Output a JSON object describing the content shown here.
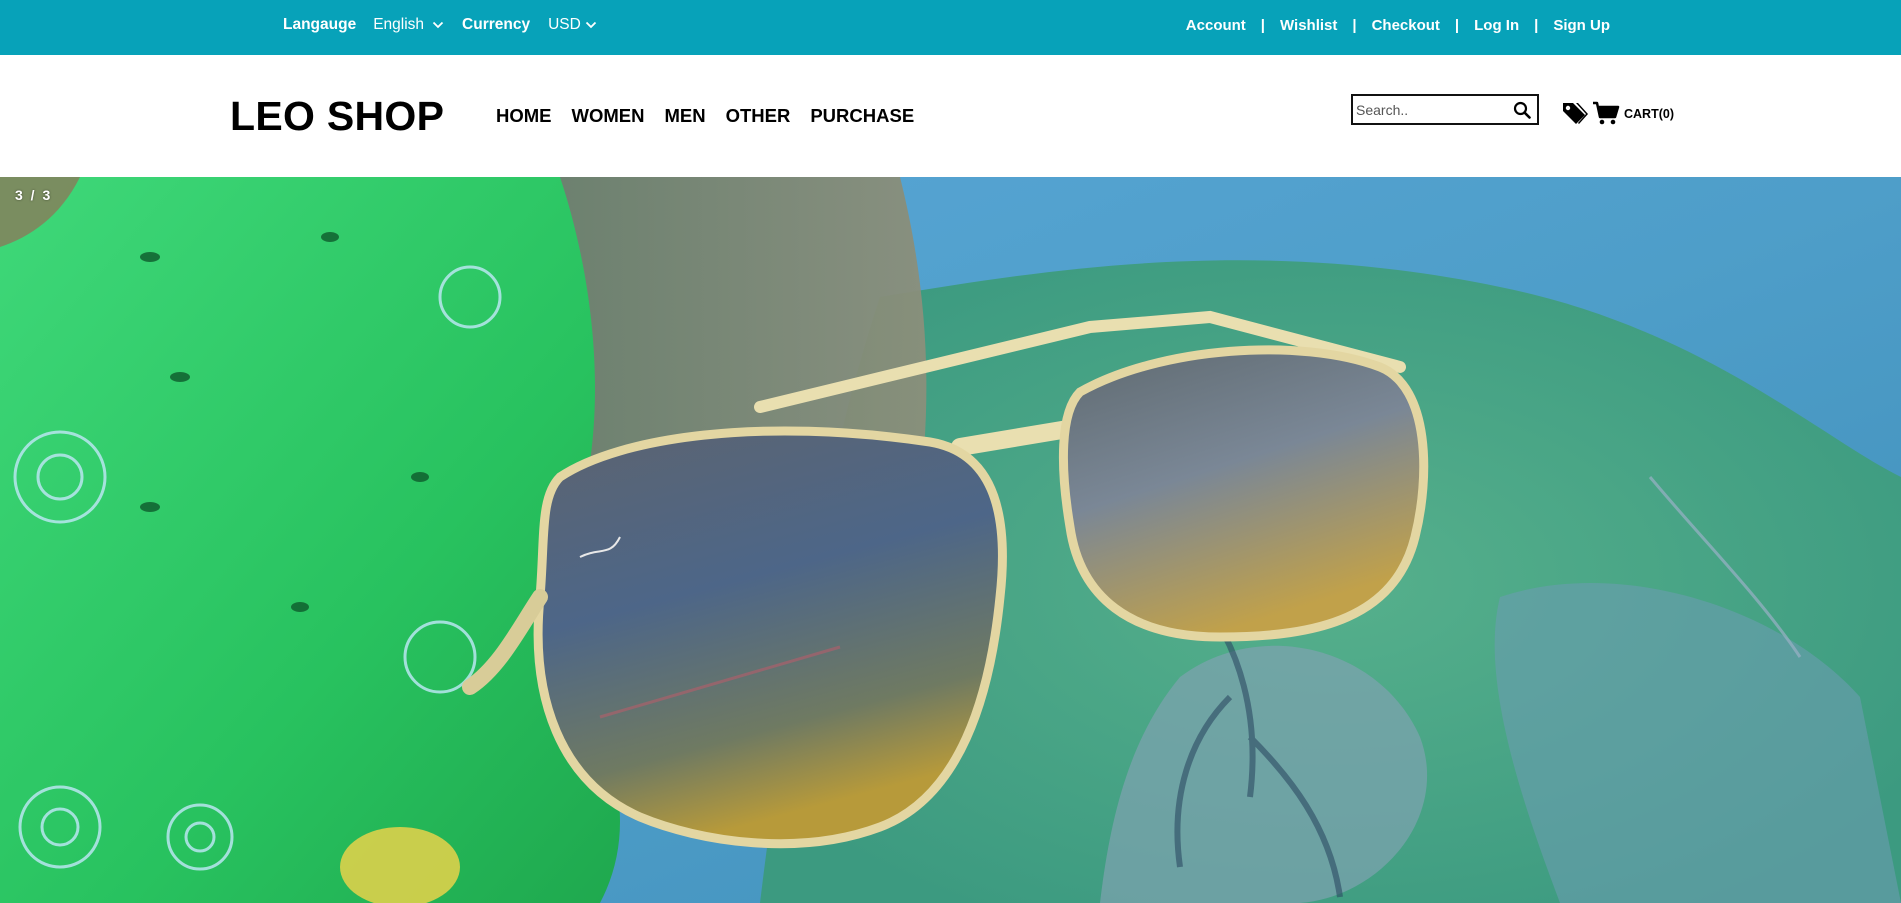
{
  "topbar": {
    "language_label": "Langauge",
    "language_value": "English",
    "currency_label": "Currency",
    "currency_value": "USD",
    "links": [
      "Account",
      "Wishlist",
      "Checkout",
      "Log In",
      "Sign Up"
    ],
    "separator": "|"
  },
  "header": {
    "logo": "LEO SHOP",
    "nav": [
      "HOME",
      "WOMEN",
      "MEN",
      "OTHER",
      "PURCHASE"
    ],
    "search_placeholder": "Search..",
    "cart_label": "CART(0)"
  },
  "hero": {
    "slide_counter": "3 / 3",
    "image_description_icon": "sunglasses-slide-image"
  },
  "icons": {
    "dropdown": "chevron-down-icon",
    "search": "search-icon",
    "tags": "tags-icon",
    "cart": "cart-icon"
  },
  "colors": {
    "topbar_bg": "#07a2b9",
    "header_bg": "#ffffff",
    "text_dark": "#000000"
  }
}
